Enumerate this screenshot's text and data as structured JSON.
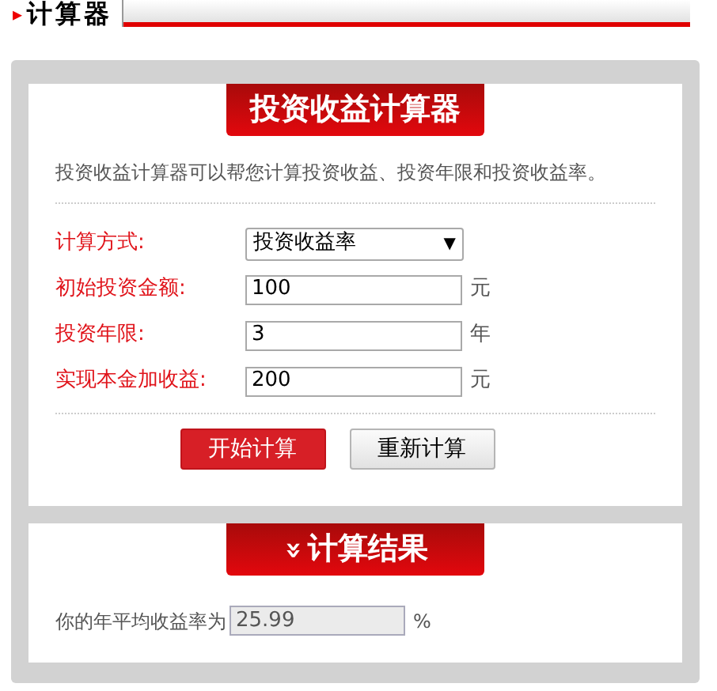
{
  "header_tab": {
    "marker": "▸",
    "title": "计算器"
  },
  "calculator": {
    "banner": "投资收益计算器",
    "description": "投资收益计算器可以帮您计算投资收益、投资年限和投资收益率。",
    "fields": [
      {
        "kind": "select",
        "label": "计算方式:",
        "value": "投资收益率",
        "arrow": "▼"
      },
      {
        "kind": "input",
        "label": "初始投资金额:",
        "value": "100",
        "unit": "元"
      },
      {
        "kind": "input",
        "label": "投资年限:",
        "value": "3",
        "unit": "年"
      },
      {
        "kind": "input",
        "label": "实现本金加收益:",
        "value": "200",
        "unit": "元"
      }
    ],
    "buttons": [
      {
        "label": "开始计算",
        "kind": "primary"
      },
      {
        "label": "重新计算",
        "kind": "secondary"
      }
    ]
  },
  "result": {
    "banner_icon": "»",
    "banner": "计算结果",
    "label": "你的年平均收益率为",
    "value": "25.99",
    "unit": "%"
  }
}
